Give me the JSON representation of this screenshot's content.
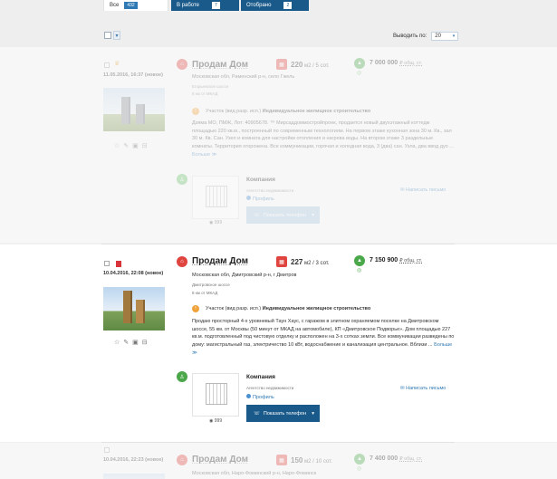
{
  "tabs": [
    {
      "label": "Все",
      "count": "432"
    },
    {
      "label": "В работе",
      "count": "7"
    },
    {
      "label": "Отобрано",
      "count": "2"
    }
  ],
  "controls": {
    "per_page_label": "Выводить по:",
    "per_page_value": "20"
  },
  "listings": [
    {
      "date": "11.05.2016, 16:37 (новое)",
      "title": "Продам Дом",
      "area_value": "220",
      "area_units": "м2 / 5 сот.",
      "price": "7 000 000",
      "price_currency": "₽ общ. ст.",
      "address": "Московская обл, Раменский р-н, село Гжель",
      "sub1": "Егорьевское шоссе",
      "sub2": "8 км от МКАД",
      "plot_label": "Участок (вид разр. исп.)",
      "plot_value": "Индивидуальное жилищное строительство",
      "description": "Дзяма МО, ПМЖ, Лот: 40905678. ™ Мирсаддоммостройпроек, продается новый двухэтажный коттедж площадью 220 кв.м., построенный по современным технологиям. На первом этаже кухонная зона 30 м. Кв., зал 30 м. Кв. Сан. Узел и комната для настройки отопления и нагрева воды. На втором этаже 3 раздельные комнаты. Территория огорожена. Все коммуникации, горячая и холодная вода, 3 (два) сан. Узла, два ввод дуо ...",
      "more": "Больше",
      "agency_name": "Компания",
      "agency_type": "Агентство недвижимости",
      "agency_profile": "Профиль",
      "agency_count": "999",
      "message": "Написать письмо",
      "phone": "Показать телефон"
    },
    {
      "date": "10.04.2016, 22:08 (новое)",
      "title": "Продам Дом",
      "area_value": "227",
      "area_units": "м2 / 3 сот.",
      "price": "7 150 900",
      "price_currency": "₽ общ. ст.",
      "address": "Московская обл, Дмитровский р-н, г Дмитров",
      "sub1": "Дмитровское шоссе",
      "sub2": "8 км от МКАД",
      "plot_label": "Участок (вид разр. исп.)",
      "plot_value": "Индивидуальное жилищное строительство",
      "description": "Продаю просторный 4-х уровневый Таун Хаус, с гаражом в элитном охраняемом поселке на Дмитровском шоссе, 55 км. от Москвы (50 минут от МКАД на автомобиле), КП «Дмитровское Подворье». Дом площадью 227 кв.м. подготовленный под чистовую отделку и расположен на 3-х сотках земли. Все коммуникации разведены по дому: магистральный газ, электричество 10 кВт, водоснабжение и канализация центральное. Вблизи ...",
      "more": "Больше",
      "agency_name": "Компания",
      "agency_type": "Агентство недвижимости",
      "agency_profile": "Профиль",
      "agency_count": "999",
      "message": "Написать письмо",
      "phone": "Показать телефон"
    },
    {
      "date": "10.04.2016, 22:23 (новое)",
      "title": "Продам Дом",
      "area_value": "150",
      "area_units": "м2 / 10 сот.",
      "price": "7 400 000",
      "price_currency": "₽ общ. ст.",
      "address": "Московская обл, Наро-Фоминский р-н, Наро-Фоминск"
    }
  ]
}
